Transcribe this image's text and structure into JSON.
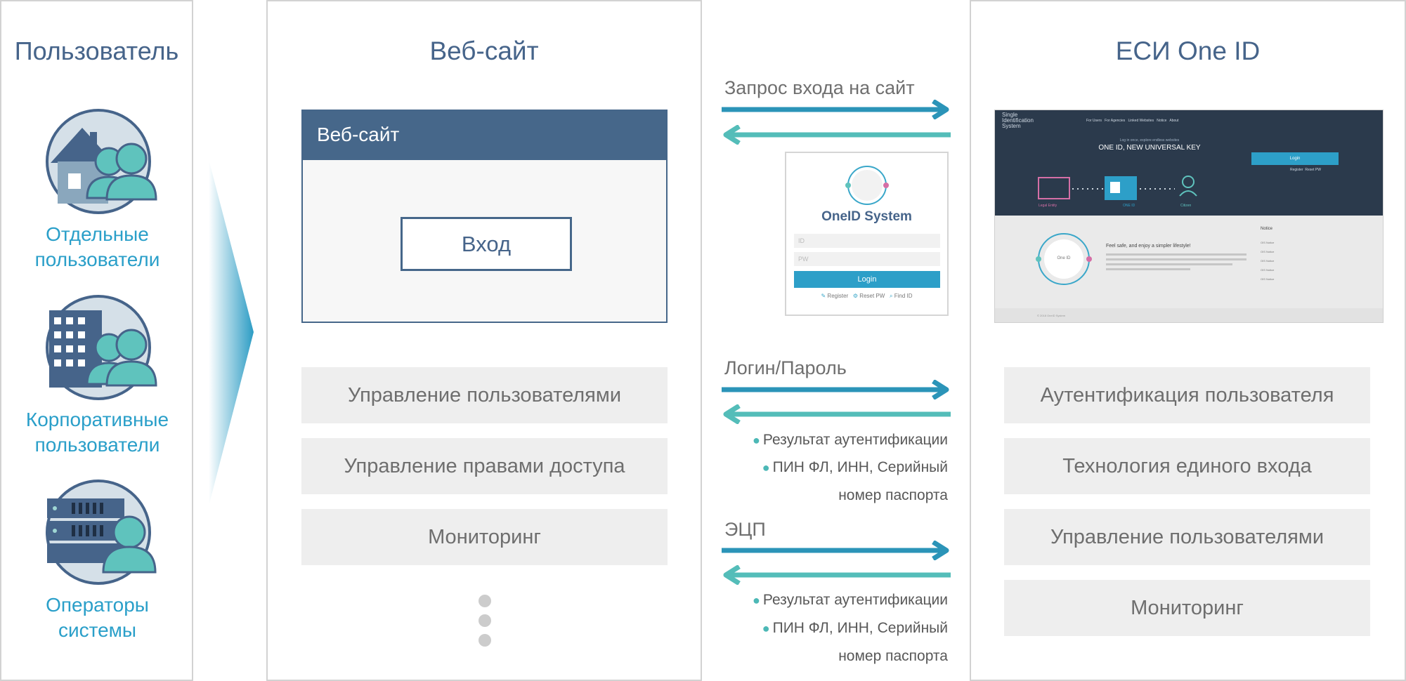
{
  "user_panel": {
    "title": "Пользователь",
    "groups": [
      {
        "label": "Отдельные\nпользователи",
        "icon": "house-users-icon"
      },
      {
        "label": "Корпоративные\nпользователи",
        "icon": "building-users-icon"
      },
      {
        "label": "Операторы\nсистемы",
        "icon": "server-operator-icon"
      }
    ]
  },
  "website_panel": {
    "title": "Веб-сайт",
    "window_title": "Веб-сайт",
    "login_button": "Вход",
    "features": [
      "Управление пользователями",
      "Управление правами доступа",
      "Мониторинг"
    ]
  },
  "flows": {
    "site_request": "Запрос входа на сайт",
    "login_password": "Логин/Пароль",
    "digital_signature": "ЭЦП",
    "results_1": [
      "Результат аутентификации",
      "ПИН ФЛ, ИНН, Серийный",
      "номер паспорта"
    ],
    "results_2": [
      "Результат аутентификации",
      "ПИН ФЛ, ИНН, Серийный",
      "номер паспорта"
    ]
  },
  "login_widget": {
    "title": "OneID System",
    "id_placeholder": "ID",
    "pw_placeholder": "PW",
    "login_button": "Login",
    "links": [
      "Register",
      "Reset PW",
      "Find ID"
    ]
  },
  "oneid_panel": {
    "title": "ЕСИ One ID",
    "features": [
      "Аутентификация пользователя",
      "Технология единого входа",
      "Управление пользователями",
      "Мониторинг"
    ]
  },
  "oneid_screenshot": {
    "brand_lines": [
      "Single",
      "Identification",
      "System"
    ],
    "nav": [
      "For Users",
      "For Agencies",
      "Linked Websites",
      "Notice",
      "About"
    ],
    "tagline": "Log in once, explore endless websites",
    "headline": "ONE ID, NEW UNIVERSAL KEY",
    "login_button": "Login",
    "register": "Register",
    "reset_pw": "Reset PW",
    "nodes": [
      "Legal Entity",
      "ONE ID",
      "Citizen"
    ],
    "circle_label": "One ID",
    "promo_title": "Feel safe, and enjoy a simpler lifestyle!",
    "notice_title": "Notice",
    "notice_items": [
      "OIS Notice",
      "OIS Notice",
      "OIS Notice",
      "OIS Notice",
      "OIS Notice"
    ],
    "footer": "© 2018 OneID System"
  },
  "colors": {
    "title_blue": "#46648a",
    "accent_cyan": "#2a9fc9",
    "arrow_blue": "#2b94b8",
    "arrow_teal": "#54bdb9",
    "header_navy": "#46678a",
    "grey_box": "#eeeeee"
  }
}
